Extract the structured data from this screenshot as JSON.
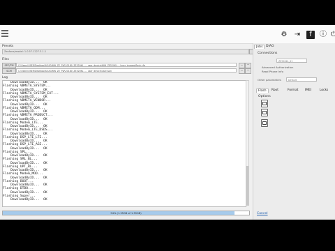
{
  "toolbar": {
    "icons": [
      "menu-icon",
      "gear-icon",
      "export-icon",
      "facebook-icon",
      "info-icon",
      "exit-icon"
    ]
  },
  "presets": {
    "label": "Presets",
    "value": "Zenfone/model: 1.0.57.1227.3.1.1"
  },
  "files": {
    "label": "Files",
    "rows": [
      {
        "button": "SPC/TM",
        "path": "C:\\Users\\USER\\Desktop\\ASUS\\WW_ZE_FW\\20180_ZE520KL_..._user_device\\WW_ZE520KL-...\\user_images\\flash.cfg"
      },
      {
        "button": "SCM",
        "path": "C:\\Users\\USER\\Desktop\\ASUS\\WW_ZE_FW\\20180_ZE520KL_..._user_device\\user.json"
      }
    ]
  },
  "log": {
    "label": "Log",
    "lines": [
      "    DownloadByID...  OK",
      "Flashing VBMETA_SYSTEM...",
      "    DownloadByID...  OK",
      "Flashing VBMETA_SYSTEM_EXT...",
      "    DownloadByID...  OK",
      "Flashing VBMETA_VENDOR...",
      "    DownloadByID...  OK",
      "Flashing VBMETA_ODM...",
      "    DownloadByID...  OK",
      "Flashing VBMETA_PRODUCT...",
      "    DownloadByID...  OK",
      "Flashing Modem_LTE...",
      "    DownloadByID...  OK",
      "Flashing Modem_LTE_DSDS...",
      "    DownloadByID...  OK",
      "Flashing DSP_LTE_LTE...",
      "    DownloadByID...  OK",
      "Flashing DSP_LTE_AGE...",
      "    DownloadByID...  OK",
      "Flashing SPL...",
      "    DownloadByID...  OK",
      "Flashing SML_BL...",
      "    DownloadByID...  OK",
      "Flashing UPT_BL...",
      "    DownloadByID...  OK",
      "Flashing Modem_MOD...",
      "    DownloadByID...  OK",
      "Flashing BOOT...",
      "    DownloadByID...  OK",
      "Flashing DTBO...",
      "    DownloadByID...  OK",
      "Flashing Super...",
      "    DownloadByID...  OK"
    ]
  },
  "progress": {
    "percent": 94,
    "text": "94% (1.35GB of 1.39GB)"
  },
  "right": {
    "tabs": [
      "Jobs",
      "DIAG"
    ],
    "connections_label": "Connections",
    "conn_value": "ZE520KL_01",
    "lines": [
      "Advanced Authorization",
      "Read Phone Info"
    ],
    "other_label": "Other parameters",
    "other_value": "Default",
    "subtabs": [
      "Flash",
      "Root",
      "Format",
      "IMEI",
      "Locks"
    ],
    "options_label": "Options",
    "cancel": "Cancel"
  }
}
